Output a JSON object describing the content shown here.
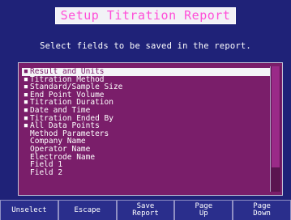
{
  "title": "Setup Titration Report",
  "prompt": "Select fields to be saved in the report.",
  "fields": [
    {
      "label": "Result and Units",
      "marked": true,
      "selected": true
    },
    {
      "label": "Titration Method",
      "marked": true
    },
    {
      "label": "Standard/Sample Size",
      "marked": true
    },
    {
      "label": "End Point Volume",
      "marked": true
    },
    {
      "label": "Titration Duration",
      "marked": true
    },
    {
      "label": "Date and Time",
      "marked": true
    },
    {
      "label": "Titration Ended By",
      "marked": true
    },
    {
      "label": "All Data Points",
      "marked": true
    },
    {
      "label": "Method Parameters",
      "marked": false
    },
    {
      "label": "Company Name",
      "marked": false
    },
    {
      "label": "Operator Name",
      "marked": false
    },
    {
      "label": "Electrode Name",
      "marked": false
    },
    {
      "label": "Field 1",
      "marked": false
    },
    {
      "label": "Field 2",
      "marked": false
    }
  ],
  "mark_symbol": "■",
  "softkeys": [
    {
      "line1": "Unselect",
      "line2": ""
    },
    {
      "line1": "Escape",
      "line2": ""
    },
    {
      "line1": "Save",
      "line2": "Report"
    },
    {
      "line1": "Page",
      "line2": "Up"
    },
    {
      "line1": "Page",
      "line2": "Down"
    }
  ],
  "colors": {
    "background": "#1f2278",
    "title_text": "#ff4fd8",
    "list_background": "#7a1e6a",
    "selected_background": "#f4f4f8"
  }
}
